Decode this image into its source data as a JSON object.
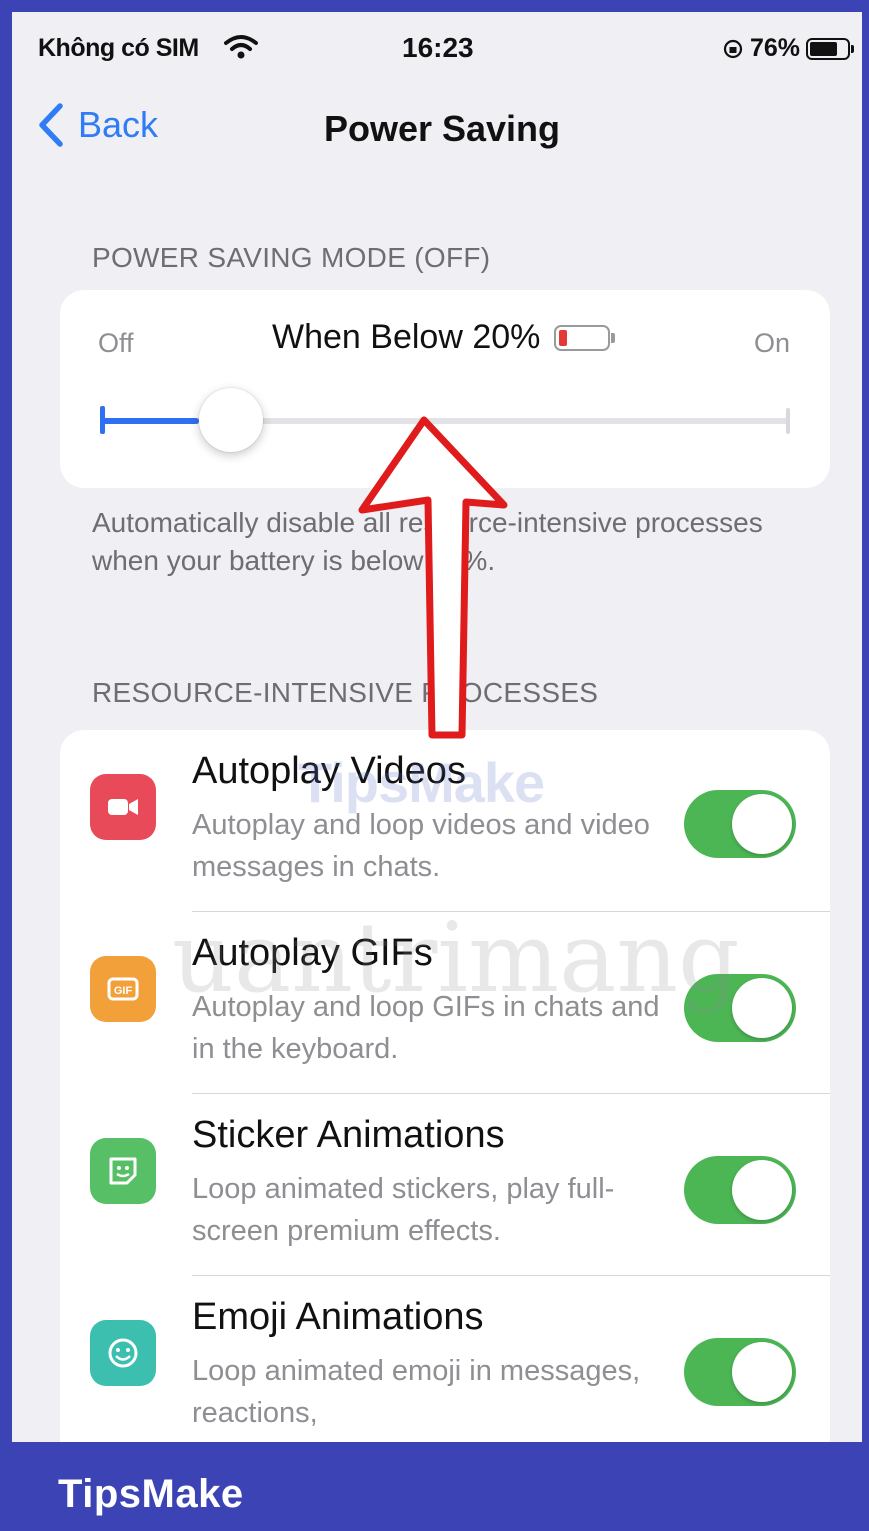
{
  "status_bar": {
    "carrier": "Không có SIM",
    "time": "16:23",
    "battery_percent_label": "76%",
    "battery_level": 0.76
  },
  "nav": {
    "back_label": "Back",
    "title": "Power Saving"
  },
  "power_saving": {
    "section_header": "POWER SAVING MODE (OFF)",
    "off_label": "Off",
    "on_label": "On",
    "threshold_label": "When Below 20%",
    "slider_value": 0.2,
    "footnote": "Automatically disable all resource-intensive processes when your battery is below 20%."
  },
  "processes": {
    "section_header": "RESOURCE-INTENSIVE PROCESSES",
    "items": [
      {
        "title": "Autoplay Videos",
        "subtitle": "Autoplay and loop videos and video messages in chats.",
        "icon": "video-camera-icon",
        "icon_color": "#e84a5a",
        "enabled": true
      },
      {
        "title": "Autoplay GIFs",
        "subtitle": "Autoplay and loop GIFs in chats and in the keyboard.",
        "icon": "gif-icon",
        "icon_color": "#f2a03a",
        "enabled": true
      },
      {
        "title": "Sticker Animations",
        "subtitle": "Loop animated stickers, play full-screen premium effects.",
        "icon": "sticker-icon",
        "icon_color": "#57c067",
        "enabled": true
      },
      {
        "title": "Emoji Animations",
        "subtitle": "Loop animated emoji in messages, reactions,",
        "icon": "emoji-icon",
        "icon_color": "#3cbfae",
        "enabled": true
      }
    ]
  },
  "watermarks": {
    "primary": "TipsMake",
    "secondary": "uantrimang"
  },
  "footer": {
    "brand": "TipsMake"
  },
  "colors": {
    "accent": "#2f7cf6",
    "toggle_on": "#4cb655",
    "slider_fill": "#2f6ff1",
    "brand_bar": "#3b43b5",
    "annotation_arrow": "#e01b1b"
  }
}
